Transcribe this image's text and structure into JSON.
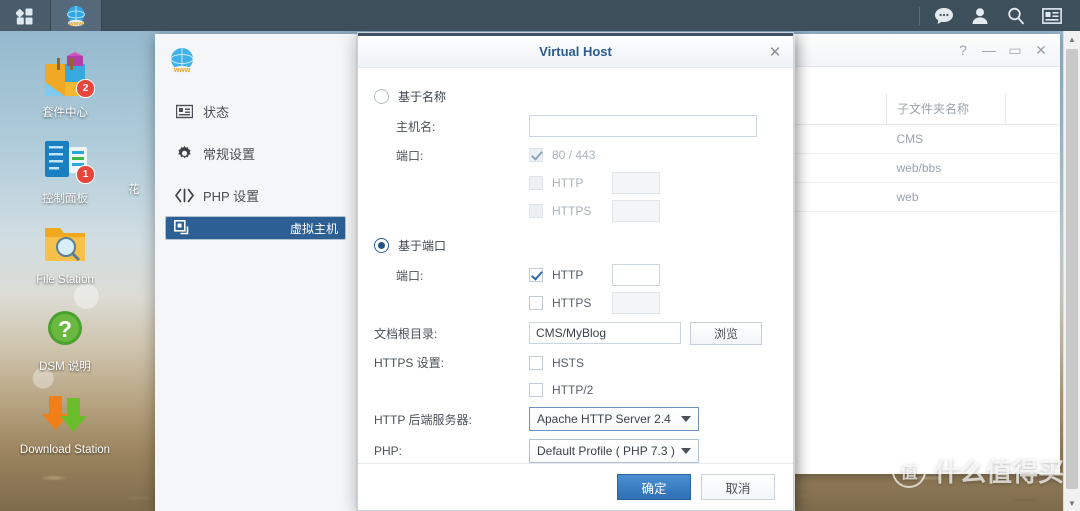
{
  "taskbar": {
    "main_menu_icon": "grid-menu-icon",
    "active_app_icon": "web-station-icon",
    "right_icons": [
      {
        "name": "notifications-icon",
        "glyph": "chat-bubble"
      },
      {
        "name": "user-account-icon",
        "glyph": "person"
      },
      {
        "name": "search-icon",
        "glyph": "magnifier"
      },
      {
        "name": "widgets-icon",
        "glyph": "card"
      }
    ]
  },
  "desktop": {
    "icons": [
      {
        "name": "package-center",
        "label": "套件中心",
        "badge": "2"
      },
      {
        "name": "control-panel",
        "label": "控制面板",
        "badge": "1"
      },
      {
        "name": "file-station",
        "label": "File Station",
        "badge": ""
      },
      {
        "name": "dsm-help",
        "label": "DSM 说明",
        "badge": ""
      },
      {
        "name": "download-station",
        "label": "Download Station",
        "badge": ""
      }
    ],
    "partial_label": "花"
  },
  "background_window": {
    "controls": [
      "?",
      "—",
      "▭",
      "✕"
    ],
    "table": {
      "headers": [
        "",
        "子文件夹名称",
        ""
      ],
      "rows": [
        [
          "",
          "CMS",
          ""
        ],
        [
          "",
          "web/bbs",
          ""
        ],
        [
          "",
          "web",
          ""
        ]
      ]
    }
  },
  "web_station": {
    "logo_icon": "web-station-globe-icon",
    "sidebar": [
      {
        "name": "status",
        "label": "状态",
        "icon": "status-card-icon",
        "selected": false
      },
      {
        "name": "general-settings",
        "label": "常规设置",
        "icon": "gear-icon",
        "selected": false
      },
      {
        "name": "php-settings",
        "label": "PHP 设置",
        "icon": "code-brackets-icon",
        "selected": false
      },
      {
        "name": "virtual-host",
        "label": "虚拟主机",
        "icon": "windows-stack-icon",
        "selected": true
      }
    ]
  },
  "dialog": {
    "title": "Virtual Host",
    "close_icon": "close-icon",
    "name_based": {
      "radio_label": "基于名称",
      "selected": false,
      "hostname_label": "主机名:",
      "hostname_value": "",
      "port_label": "端口:",
      "port_default_label": "80 / 443",
      "port_default_checked": true,
      "http_label": "HTTP",
      "http_checked": false,
      "http_value": "",
      "https_label": "HTTPS",
      "https_checked": false,
      "https_value": ""
    },
    "port_based": {
      "radio_label": "基于端口",
      "selected": true,
      "port_label": "端口:",
      "http_label": "HTTP",
      "http_checked": true,
      "http_value": "",
      "https_label": "HTTPS",
      "https_checked": false,
      "https_value": ""
    },
    "docroot_label": "文档根目录:",
    "docroot_value": "CMS/MyBlog",
    "browse_button": "浏览",
    "https_settings_label": "HTTPS 设置:",
    "hsts_label": "HSTS",
    "hsts_checked": false,
    "http2_label": "HTTP/2",
    "http2_checked": false,
    "backend_label": "HTTP 后端服务器:",
    "backend_value": "Apache HTTP Server 2.4",
    "php_label": "PHP:",
    "php_value": "Default Profile ( PHP 7.3 )",
    "ok_button": "确定",
    "cancel_button": "取消"
  },
  "watermark": {
    "mark": "值",
    "text": "什么值得买"
  },
  "colors": {
    "accent": "#2c5f93",
    "title_blue": "#2a5d91",
    "taskbar": "#3e4f5c",
    "primary_button": "#2f6fb5",
    "badge_red": "#e8453c"
  }
}
